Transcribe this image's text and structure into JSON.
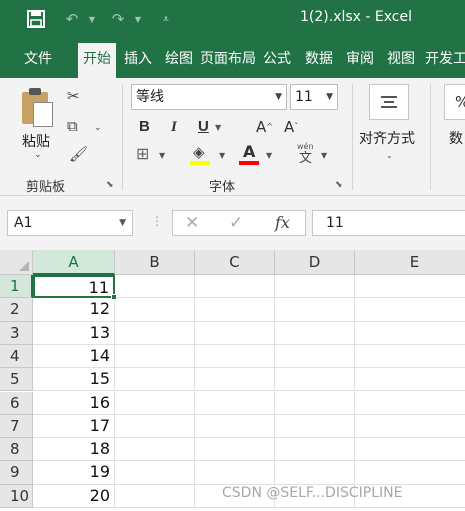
{
  "titlebar": {
    "save_icon": "save-icon",
    "undo_icon": "undo-icon",
    "redo_icon": "redo-icon",
    "customize_icon": "customize-qat-icon",
    "title": "1(2).xlsx  -  Excel"
  },
  "tabs": [
    "文件",
    "开始",
    "插入",
    "绘图",
    "页面布局",
    "公式",
    "数据",
    "审阅",
    "视图",
    "开发工具"
  ],
  "active_tab": "开始",
  "ribbon": {
    "clipboard": {
      "paste_label": "粘贴",
      "group_label": "剪贴板",
      "cut_icon": "scissors-icon",
      "copy_icon": "copy-icon",
      "format_painter_icon": "format-painter-icon"
    },
    "font": {
      "font_name": "等线",
      "font_size": "11",
      "bold": "B",
      "italic": "I",
      "underline": "U",
      "grow": "A",
      "shrink": "A",
      "phonetic": "文",
      "phonetic_top": "wén",
      "group_label": "字体",
      "fill_color": "#ffff00",
      "font_color": "#ff0000"
    },
    "alignment": {
      "label": "对齐方式"
    },
    "number": {
      "label": "数"
    }
  },
  "formula_bar": {
    "name_box": "A1",
    "cancel": "✕",
    "enter": "✓",
    "fx": "fx",
    "value": "11"
  },
  "grid": {
    "columns": [
      "A",
      "B",
      "C",
      "D",
      "E"
    ],
    "rows": [
      "1",
      "2",
      "3",
      "4",
      "5",
      "6",
      "7",
      "8",
      "9",
      "10"
    ],
    "a_values": [
      "11",
      "12",
      "13",
      "14",
      "15",
      "16",
      "17",
      "18",
      "19",
      "20"
    ],
    "active_cell": "A1"
  },
  "watermark": "CSDN @SELF...DISCIPLINE",
  "colors": {
    "accent": "#217346",
    "ribbon_bg": "#f3f3f3"
  }
}
